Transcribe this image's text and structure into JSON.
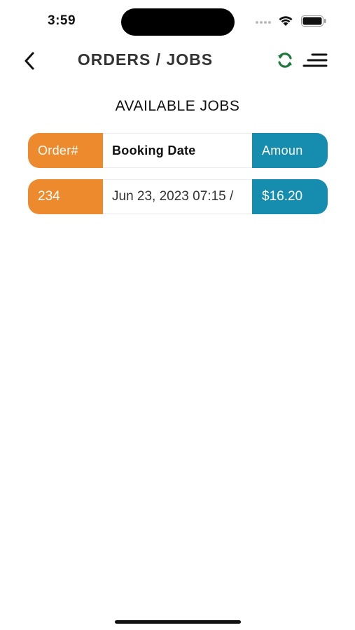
{
  "status_bar": {
    "time": "3:59"
  },
  "nav": {
    "back_icon": "chevron-left-icon",
    "title": "ORDERS / JOBS",
    "refresh_icon": "refresh-icon",
    "menu_icon": "menu-icon",
    "accent_green": "#1e7a3c"
  },
  "section": {
    "title": "AVAILABLE JOBS"
  },
  "table": {
    "columns": [
      "Order#",
      "Booking Date",
      "Amoun"
    ],
    "rows": [
      {
        "order": "234",
        "booking_date": "Jun 23, 2023 07:15 /",
        "amount": "$16.20"
      }
    ]
  },
  "colors": {
    "order_column": "#ed8a2d",
    "amount_column": "#168dae"
  }
}
